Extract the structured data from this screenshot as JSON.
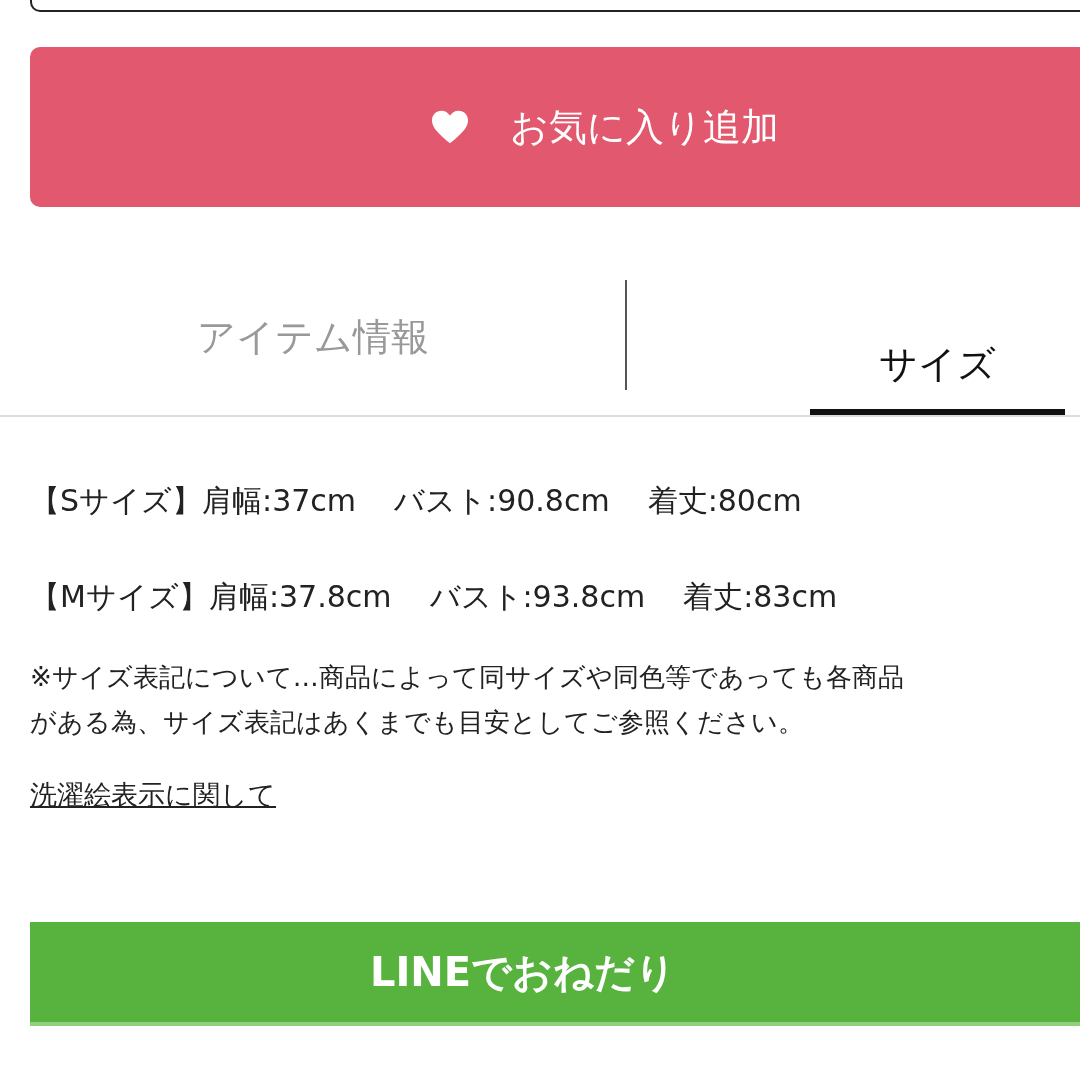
{
  "favorite_button": {
    "label": "お気に入り追加"
  },
  "tabs": [
    {
      "label": "アイテム情報",
      "selected": false
    },
    {
      "label": "サイズ",
      "selected": true
    }
  ],
  "sizes": [
    {
      "label": "【Sサイズ】",
      "measurements": [
        "肩幅:37cm",
        "バスト:90.8cm",
        "着丈:80cm"
      ]
    },
    {
      "label": "【Mサイズ】",
      "measurements": [
        "肩幅:37.8cm",
        "バスト:93.8cm",
        "着丈:83cm"
      ]
    }
  ],
  "note": [
    "※サイズ表記について…商品によって同サイズや同色等であっても各商品",
    "がある為、サイズ表記はあくまでも目安としてご参照ください。"
  ],
  "link": "洗濯絵表示に関して",
  "line_button": {
    "label": "LINEでおねだり"
  }
}
